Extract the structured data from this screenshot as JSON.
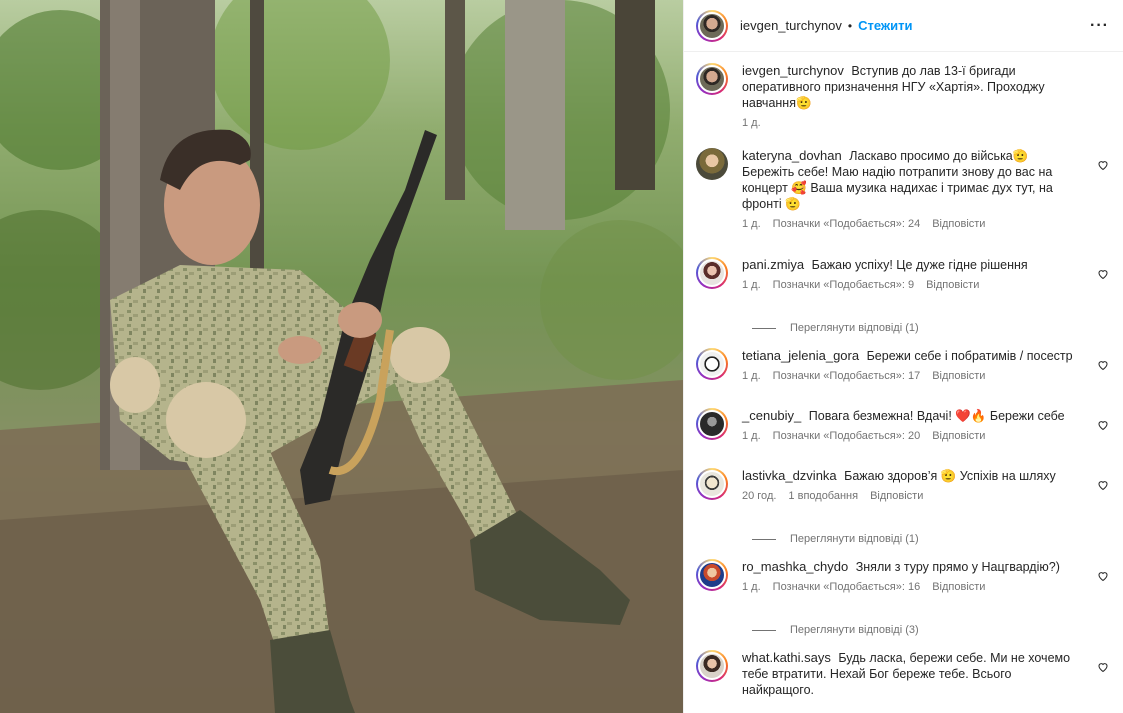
{
  "header": {
    "username": "ievgen_turchynov",
    "separator": "•",
    "follow_label": "Стежити",
    "more_label": "···"
  },
  "caption": {
    "username": "ievgen_turchynov",
    "text": "Вступив до лав 13-ї бригади оперативного призначення НГУ «Хартія». Проходжу навчання🫡",
    "time": "1 д."
  },
  "comments": [
    {
      "username": "kateryna_dovhan",
      "text": "Ласкаво просимо до війська🫡 Бережіть себе! Маю надію потрапити знову до вас на концерт 🥰 Ваша музика надихає і тримає дух тут, на фронті 🫡",
      "time": "1 д.",
      "likes": "Позначки «Подобається»: 24",
      "reply": "Відповісти"
    },
    {
      "username": "pani.zmiya",
      "text": "Бажаю успіху! Це дуже гідне рішення",
      "time": "1 д.",
      "likes": "Позначки «Подобається»: 9",
      "reply": "Відповісти",
      "view_replies": "Переглянути відповіді (1)"
    },
    {
      "username": "tetiana_jelenia_gora",
      "text": "Бережи себе і побратимів / посестр",
      "time": "1 д.",
      "likes": "Позначки «Подобається»: 17",
      "reply": "Відповісти"
    },
    {
      "username": "_cenubiy_",
      "text": "Повага безмежна! Вдачі! ❤️🔥 Бережи себе",
      "time": "1 д.",
      "likes": "Позначки «Подобається»: 20",
      "reply": "Відповісти"
    },
    {
      "username": "lastivka_dzvinka",
      "text": "Бажаю здоров’я 🫡 Успіхів на шляху",
      "time": "20 год.",
      "likes": "1 вподобання",
      "reply": "Відповісти",
      "view_replies": "Переглянути відповіді (1)"
    },
    {
      "username": "ro_mashka_chydo",
      "text": "Зняли з туру прямо у Нацгвардію?)",
      "time": "1 д.",
      "likes": "Позначки «Подобається»: 16",
      "reply": "Відповісти",
      "view_replies": "Переглянути відповіді (3)"
    },
    {
      "username": "what.kathi.says",
      "text": "Будь ласка, бережи себе. Ми не хочемо тебе втратити. Нехай Бог береже тебе. Всього найкращого."
    }
  ],
  "colors": {
    "follow": "#0095f6",
    "muted": "#737373"
  }
}
